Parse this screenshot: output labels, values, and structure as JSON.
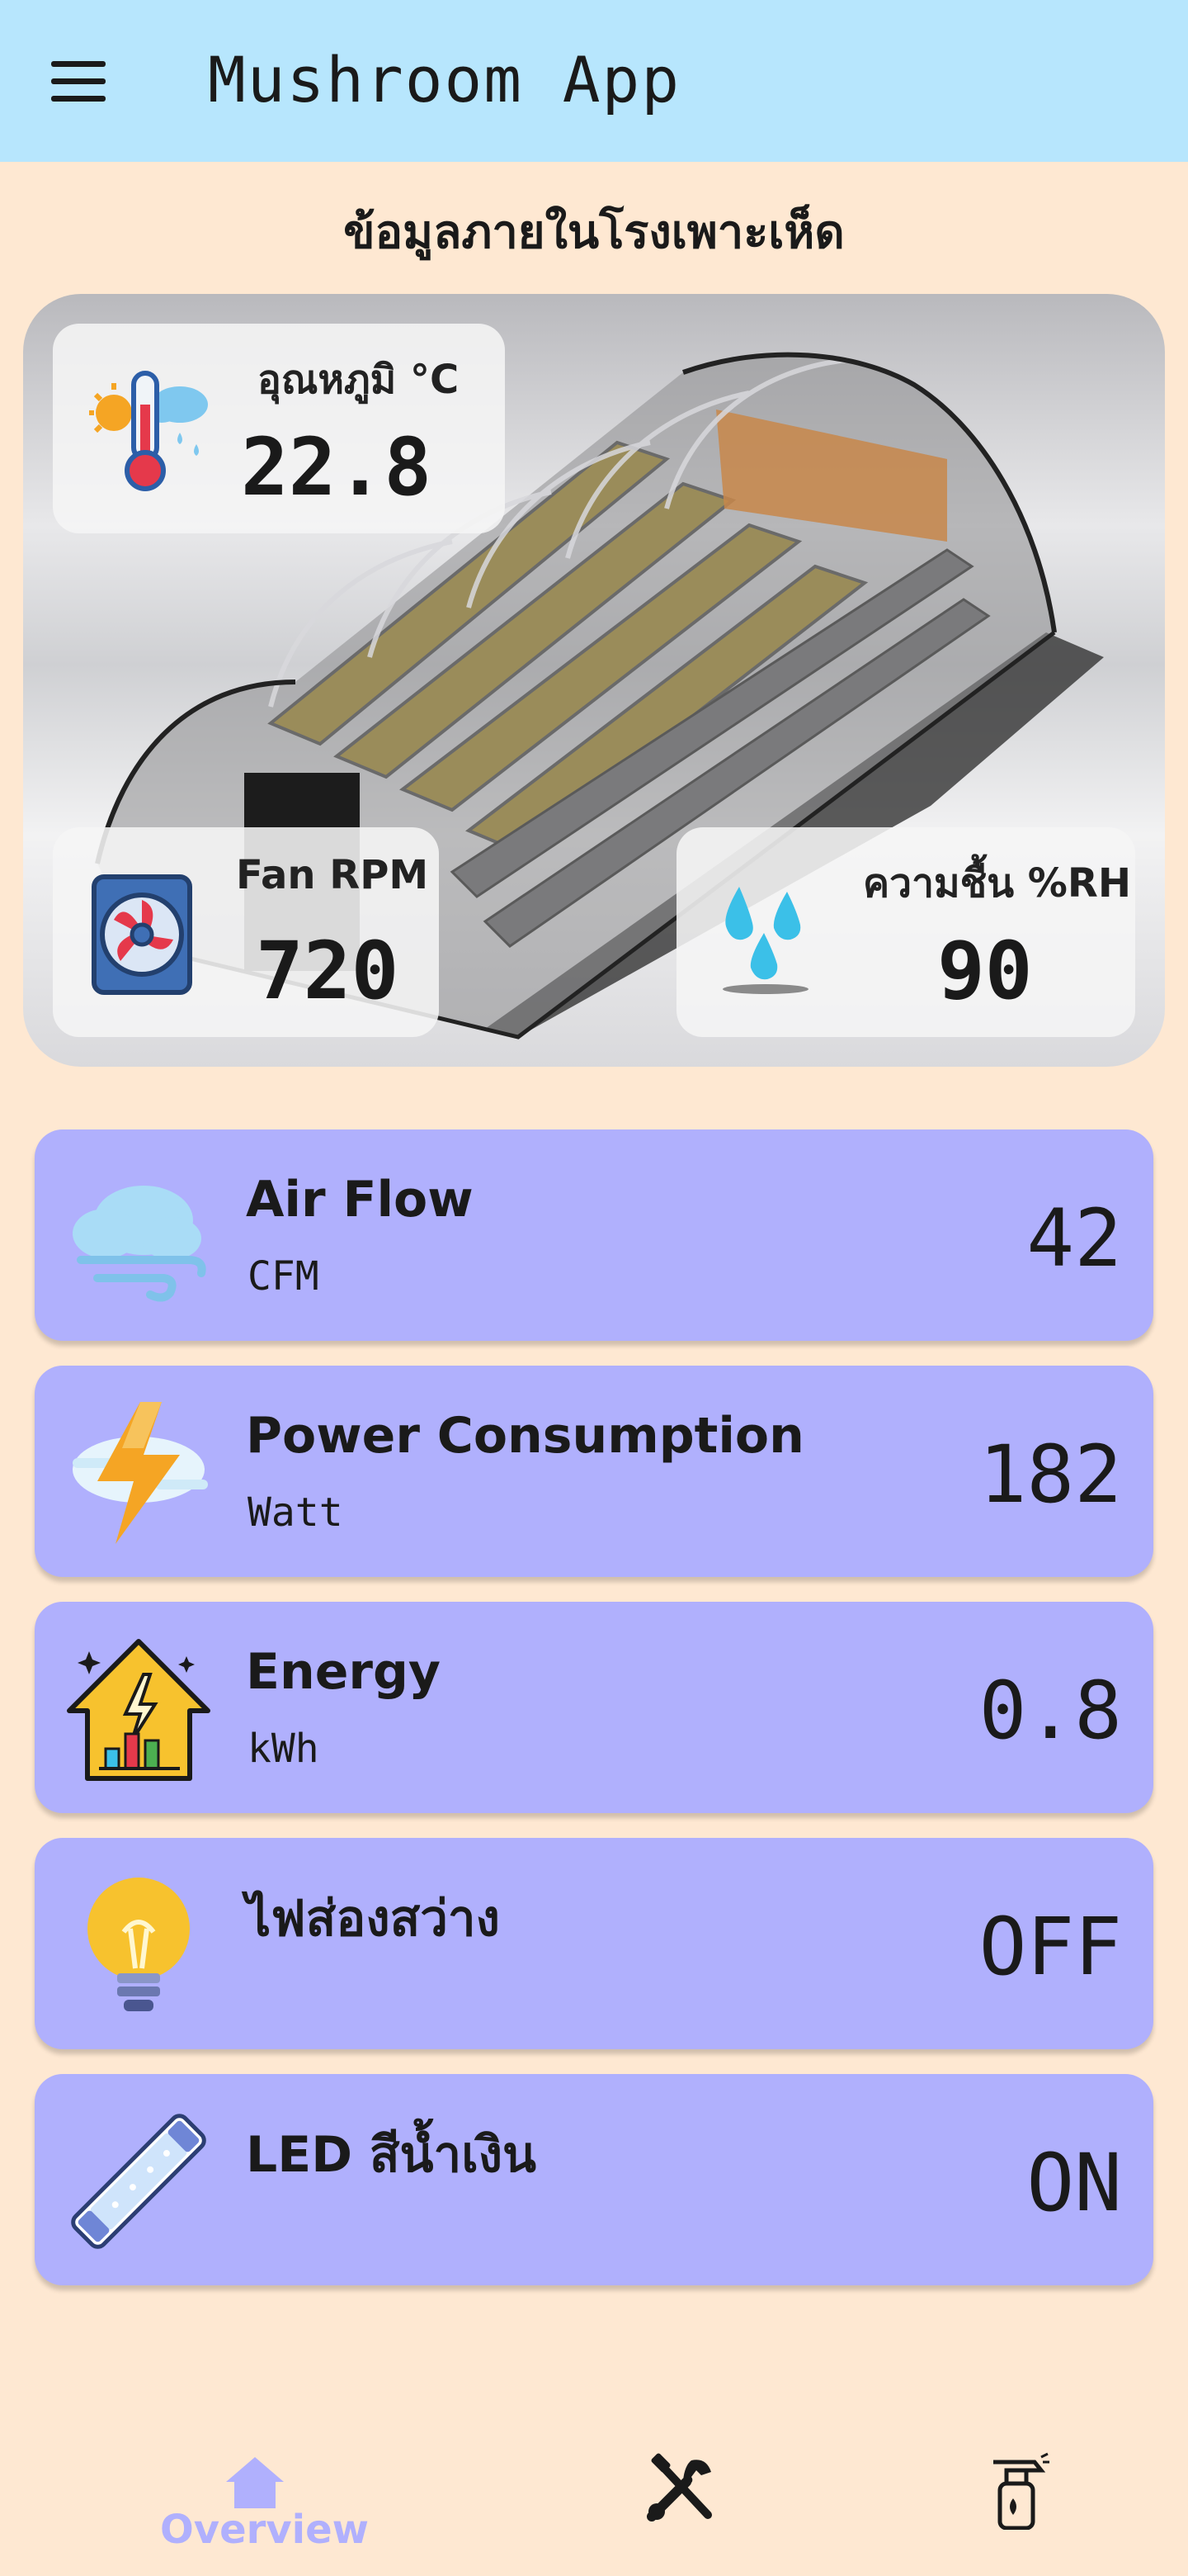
{
  "app": {
    "title": "Mushroom App"
  },
  "section_title": "ข้อมูลภายในโรงเพาะเห็ด",
  "stats": {
    "temperature": {
      "label": "อุณหภูมิ °C",
      "value": "22.8",
      "icon": "thermometer-sun-icon"
    },
    "fan": {
      "label": "Fan RPM",
      "value": "720",
      "icon": "fan-icon"
    },
    "humidity": {
      "label": "ความชื้น %RH",
      "value": "90",
      "icon": "water-drops-icon"
    }
  },
  "cards": [
    {
      "title": "Air Flow",
      "unit": "CFM",
      "value": "42",
      "icon": "wind-cloud-icon"
    },
    {
      "title": "Power Consumption",
      "unit": "Watt",
      "value": "182",
      "icon": "lightning-icon"
    },
    {
      "title": "Energy",
      "unit": "kWh",
      "value": "0.8",
      "icon": "energy-house-icon"
    },
    {
      "title": "ไฟส่องสว่าง",
      "unit": "",
      "value": "OFF",
      "icon": "light-bulb-icon"
    },
    {
      "title": "LED สีน้ำเงิน",
      "unit": "",
      "value": "ON",
      "icon": "led-tube-icon"
    }
  ],
  "bottom_nav": [
    {
      "label": "Overview",
      "icon": "home-icon",
      "active": true
    },
    {
      "label": "",
      "icon": "tools-icon",
      "active": false
    },
    {
      "label": "",
      "icon": "spray-bottle-icon",
      "active": false
    }
  ],
  "colors": {
    "background": "#fee8d2",
    "appbar": "#b7e6fd",
    "card": "#b0b0fd",
    "nav_active": "#b0b0fd"
  }
}
